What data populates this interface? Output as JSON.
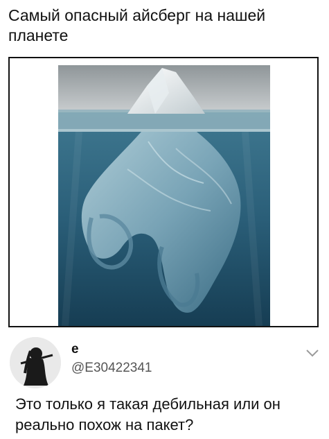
{
  "meme": {
    "title": "Самый опасный айсберг на нашей планете"
  },
  "tweet": {
    "author_name": "e",
    "handle": "@E30422341",
    "text": "Это только я такая дебильная или он реально похож на пакет?",
    "menu_icon": "chevron-down-icon",
    "avatar_icon": "avatar-silhouette"
  },
  "colors": {
    "sky": "#b9bfc2",
    "water_surface": "#7fa7b4",
    "deep_water": "#1f4f68",
    "bag": "#8fb8c8"
  }
}
